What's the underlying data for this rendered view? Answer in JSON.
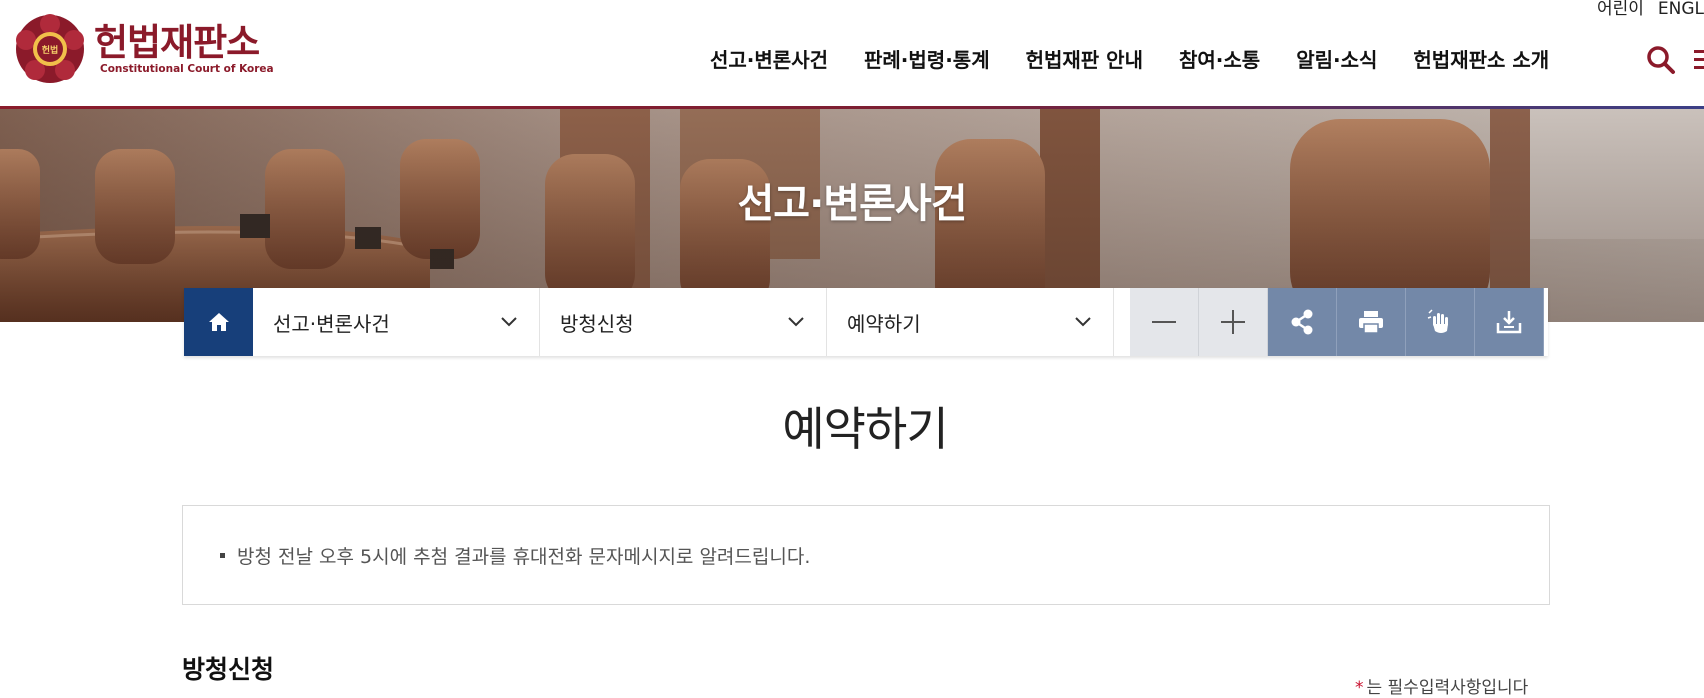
{
  "util": {
    "kids": "어린이",
    "english": "ENGL"
  },
  "logo": {
    "name_ko": "헌법재판소",
    "name_en": "Constitutional Court of Korea",
    "emblem_text": "헌법"
  },
  "gnb": {
    "items": [
      "선고·변론사건",
      "판례·법령·통계",
      "헌법재판 안내",
      "참여·소통",
      "알림·소식",
      "헌법재판소 소개"
    ]
  },
  "hero": {
    "title": "선고·변론사건"
  },
  "location": {
    "depth1": "선고·변론사건",
    "depth2": "방청신청",
    "depth3": "예약하기"
  },
  "tools": [
    "zoom-out",
    "zoom-in",
    "share",
    "print",
    "hand",
    "download"
  ],
  "page": {
    "title": "예약하기"
  },
  "notice": {
    "items": [
      "방청 전날 오후 5시에 추첨 결과를 휴대전화 문자메시지로 알려드립니다."
    ]
  },
  "section": {
    "title": "방청신청",
    "required_mark": "*",
    "required_note": "는 필수입력사항입니다"
  },
  "colors": {
    "brand": "#8b1a2a",
    "navy": "#173f7a",
    "tool_dark": "#7388a8",
    "tool_light": "#e4e6ea"
  }
}
